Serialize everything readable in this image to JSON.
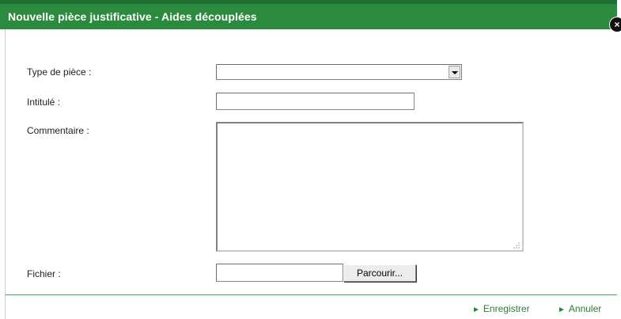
{
  "dialog": {
    "title": "Nouvelle pièce justificative - Aides découplées",
    "close_icon": "close-icon"
  },
  "form": {
    "type_label": "Type de pièce :",
    "type_value": "",
    "title_label": "Intitulé :",
    "title_value": "",
    "comment_label": "Commentaire :",
    "comment_value": "",
    "file_label": "Fichier :",
    "file_value": "",
    "browse_label": "Parcourir..."
  },
  "actions": {
    "save_label": "Enregistrer",
    "cancel_label": "Annuler",
    "arrow_icon": "play-arrow-icon"
  },
  "colors": {
    "title_bar": "#2a8a3e",
    "link": "#2b7a3a",
    "divider": "#3fae5a"
  }
}
